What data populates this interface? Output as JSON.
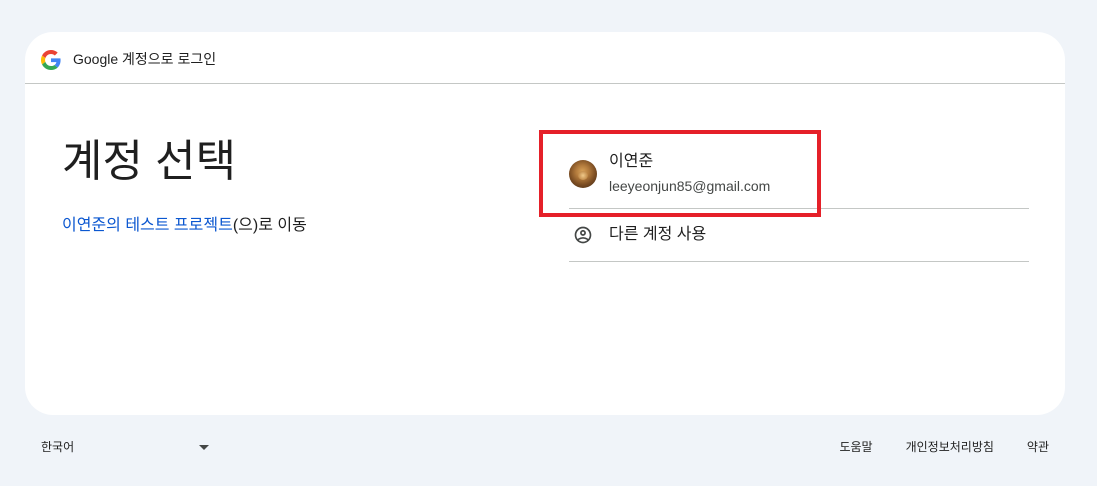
{
  "header": {
    "logo_icon": "google-g-logo-icon",
    "title": "Google 계정으로 로그인"
  },
  "main": {
    "heading": "계정 선택",
    "subtitle_link": "이연준의 테스트 프로젝트",
    "subtitle_suffix": "(으)로 이동"
  },
  "account_list": {
    "accounts": [
      {
        "name": "이연준",
        "email": "leeyeonjun85@gmail.com",
        "avatar_icon": "avatar-photo"
      }
    ],
    "use_another_account": {
      "label": "다른 계정 사용",
      "icon": "account-circle-icon"
    }
  },
  "footer": {
    "language": "한국어",
    "language_icon": "arrow-drop-down-icon",
    "links": [
      "도움말",
      "개인정보처리방침",
      "약관"
    ]
  },
  "colors": {
    "page_background": "#f0f4f9",
    "card_background": "#ffffff",
    "text_primary": "#1f1f1f",
    "text_secondary": "#444746",
    "link": "#0b57d0",
    "divider": "#c4c7c5",
    "highlight_annotation": "#e52029"
  }
}
